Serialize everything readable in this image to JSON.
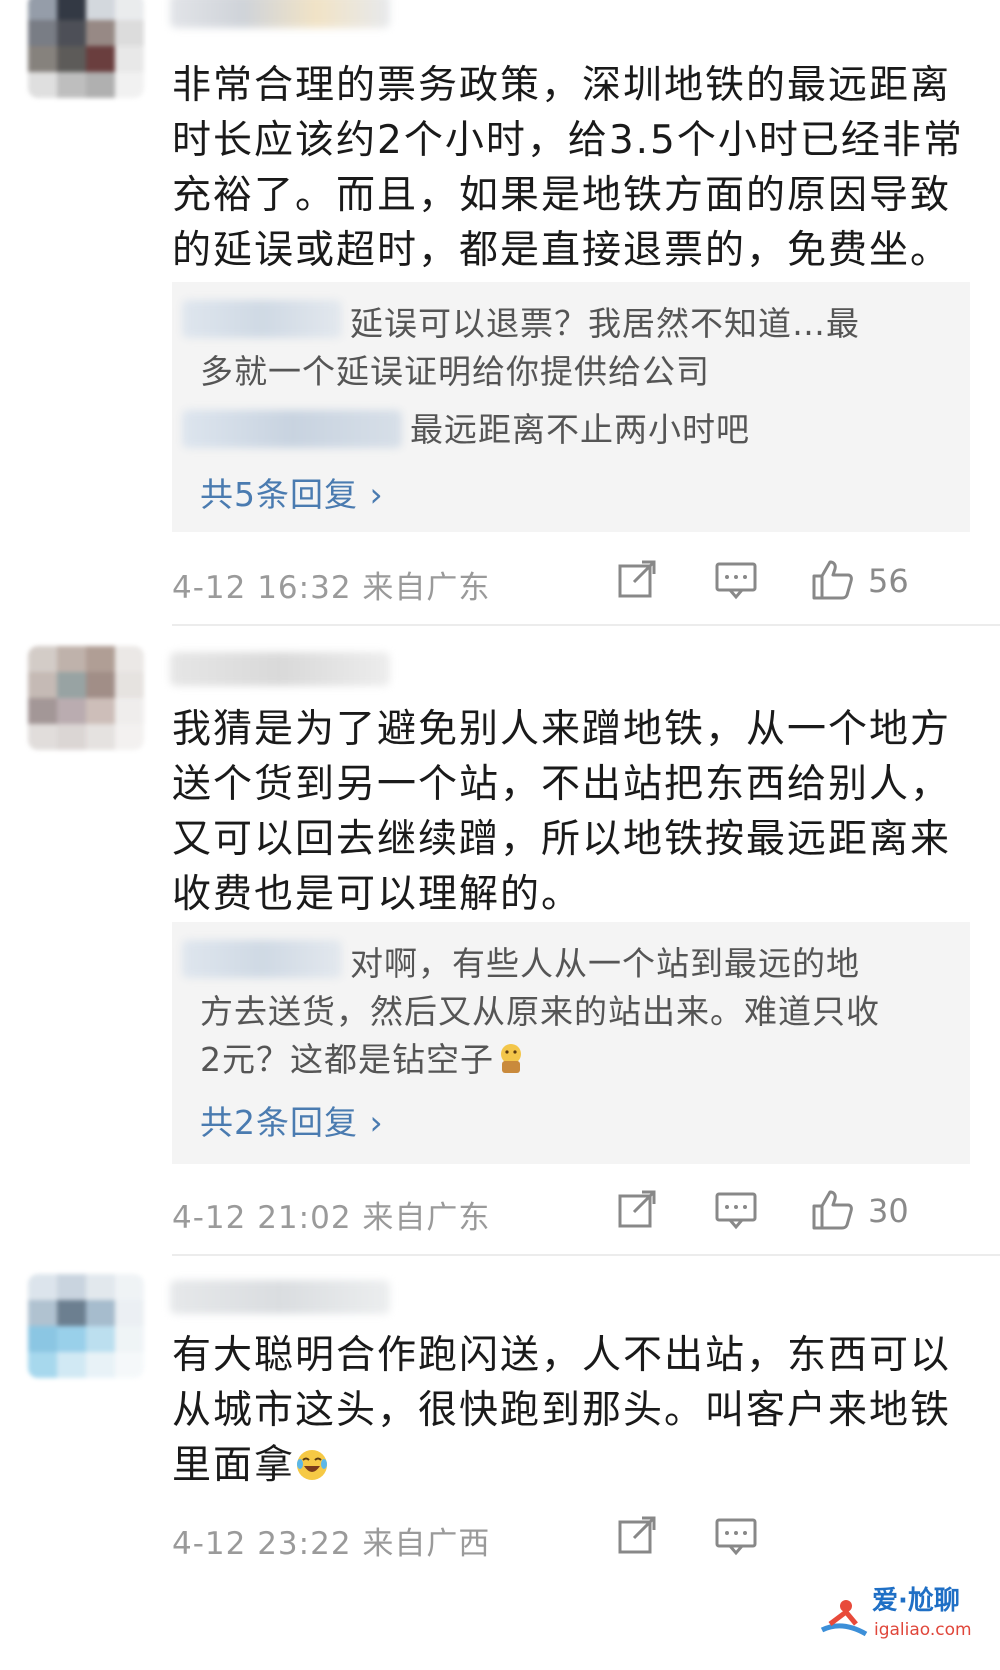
{
  "comments": [
    {
      "text": "非常合理的票务政策，深圳地铁的最远距离\n时长应该约2个小时，给3.5个小时已经非常\n充裕了。而且，如果是地铁方面的原因导致\n的延误或超时，都是直接退票的，免费坐。",
      "replies": [
        {
          "text": "延误可以退票？我居然不知道…最\n多就一个延误证明给你提供给公司"
        },
        {
          "text": "最远距离不止两小时吧"
        }
      ],
      "more": "共5条回复 ›",
      "time": "4-12 16:32",
      "source": "来自广东",
      "likes": "56"
    },
    {
      "text": "我猜是为了避免别人来蹭地铁，从一个地方\n送个货到另一个站，不出站把东西给别人，\n又可以回去继续蹭，所以地铁按最远距离来\n收费也是可以理解的。",
      "replies": [
        {
          "text": "对啊，有些人从一个站到最远的地\n方去送货，然后又从原来的站出来。难道只收\n2元？这都是钻空子"
        }
      ],
      "more": "共2条回复 ›",
      "time": "4-12 21:02",
      "source": "来自广东",
      "likes": "30"
    },
    {
      "text": "有大聪明合作跑闪送，人不出站，东西可以\n从城市这头，很快跑到那头。叫客户来地铁\n里面拿",
      "replies": [],
      "more": "",
      "time": "4-12 23:22",
      "source": "来自广西",
      "likes": ""
    }
  ],
  "watermark": {
    "brand": "爱·尬聊",
    "site": "igaliao.com"
  },
  "colors": {
    "link": "#4a7bb0",
    "meta": "#9a9a9a",
    "replyBg": "#f4f4f4"
  },
  "icons": [
    "share-icon",
    "comment-icon",
    "like-icon",
    "thinking-emoji-icon",
    "laughing-crying-emoji-icon"
  ]
}
